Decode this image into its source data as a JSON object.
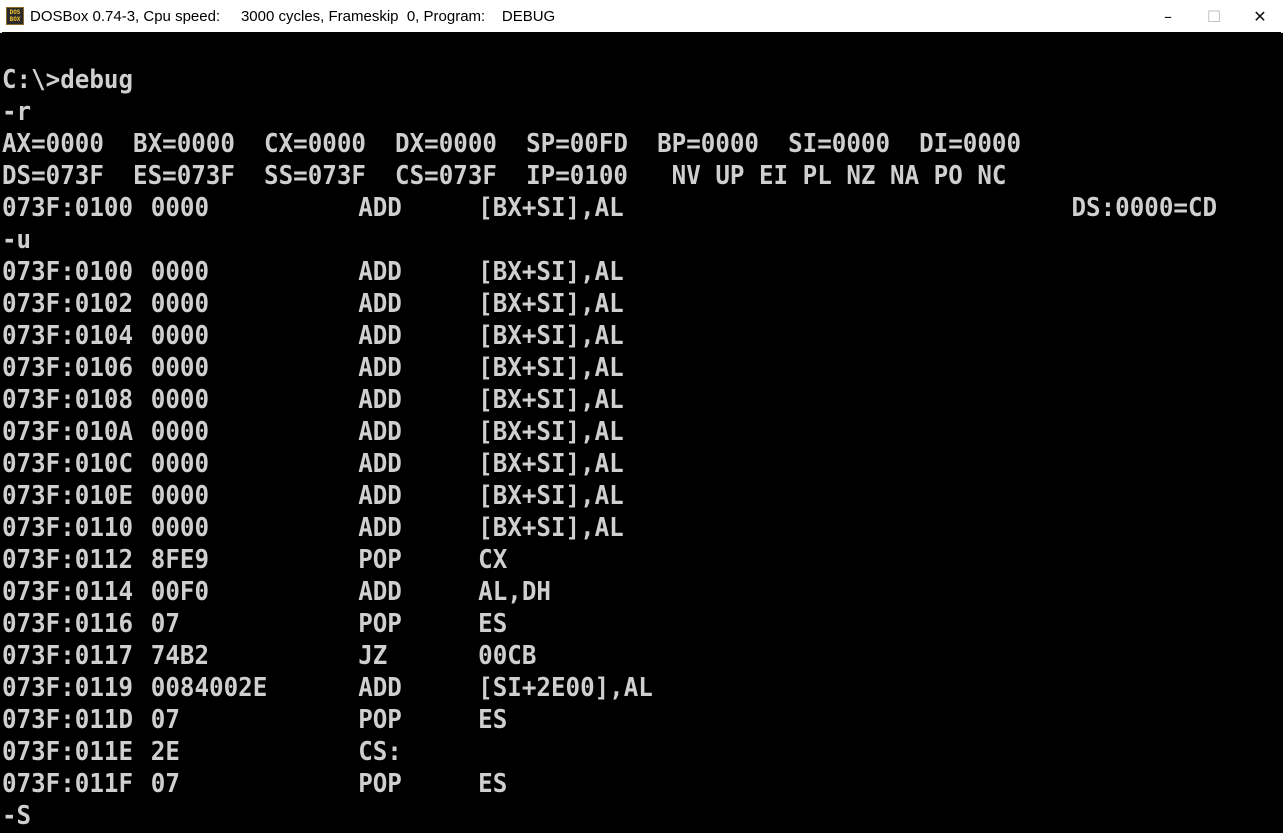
{
  "window": {
    "title": "DOSBox 0.74-3, Cpu speed:     3000 cycles, Frameskip  0, Program:    DEBUG",
    "icon": {
      "name": "dosbox-icon",
      "text_top": "DOS",
      "text_bottom": "BOX"
    },
    "controls": {
      "minimize": "–",
      "maximize": "☐",
      "close": "✕"
    }
  },
  "console": {
    "prompt": "C:\\>debug",
    "cmd_r": "-r",
    "regs1": "AX=0000  BX=0000  CX=0000  DX=0000  SP=00FD  BP=0000  SI=0000  DI=0000",
    "regs2": "DS=073F  ES=073F  SS=073F  CS=073F  IP=0100   NV UP EI PL NZ NA PO NC",
    "current": {
      "addr": "073F:0100",
      "bytes": "0000",
      "op": "ADD",
      "args": "[BX+SI],AL",
      "ea": "DS:0000=CD"
    },
    "cmd_u": "-u",
    "disasm": [
      {
        "addr": "073F:0100",
        "bytes": "0000",
        "op": "ADD",
        "args": "[BX+SI],AL"
      },
      {
        "addr": "073F:0102",
        "bytes": "0000",
        "op": "ADD",
        "args": "[BX+SI],AL"
      },
      {
        "addr": "073F:0104",
        "bytes": "0000",
        "op": "ADD",
        "args": "[BX+SI],AL"
      },
      {
        "addr": "073F:0106",
        "bytes": "0000",
        "op": "ADD",
        "args": "[BX+SI],AL"
      },
      {
        "addr": "073F:0108",
        "bytes": "0000",
        "op": "ADD",
        "args": "[BX+SI],AL"
      },
      {
        "addr": "073F:010A",
        "bytes": "0000",
        "op": "ADD",
        "args": "[BX+SI],AL"
      },
      {
        "addr": "073F:010C",
        "bytes": "0000",
        "op": "ADD",
        "args": "[BX+SI],AL"
      },
      {
        "addr": "073F:010E",
        "bytes": "0000",
        "op": "ADD",
        "args": "[BX+SI],AL"
      },
      {
        "addr": "073F:0110",
        "bytes": "0000",
        "op": "ADD",
        "args": "[BX+SI],AL"
      },
      {
        "addr": "073F:0112",
        "bytes": "8FE9",
        "op": "POP",
        "args": "CX"
      },
      {
        "addr": "073F:0114",
        "bytes": "00F0",
        "op": "ADD",
        "args": "AL,DH"
      },
      {
        "addr": "073F:0116",
        "bytes": "07",
        "op": "POP",
        "args": "ES"
      },
      {
        "addr": "073F:0117",
        "bytes": "74B2",
        "op": "JZ",
        "args": "00CB"
      },
      {
        "addr": "073F:0119",
        "bytes": "0084002E",
        "op": "ADD",
        "args": "[SI+2E00],AL"
      },
      {
        "addr": "073F:011D",
        "bytes": "07",
        "op": "POP",
        "args": "ES"
      },
      {
        "addr": "073F:011E",
        "bytes": "2E",
        "op": "CS:",
        "args": ""
      },
      {
        "addr": "073F:011F",
        "bytes": "07",
        "op": "POP",
        "args": "ES"
      }
    ],
    "last_input": "-S",
    "colors": {
      "background": "#000000",
      "text": "#cfcfcf"
    }
  }
}
